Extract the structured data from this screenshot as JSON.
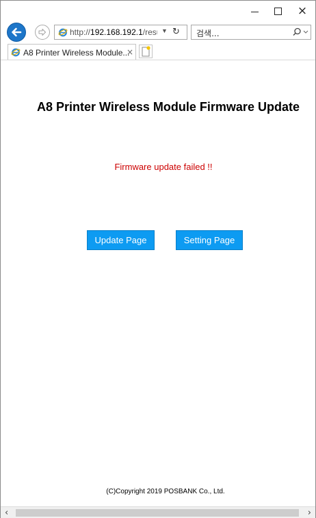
{
  "window": {
    "controls": {
      "minimize": "minimize",
      "maximize": "maximize",
      "close": "×"
    }
  },
  "address_bar": {
    "url_prefix": "http://",
    "url_host": "192.168.192.1",
    "url_rest": "/resu",
    "search_placeholder": "검색..."
  },
  "tab": {
    "title": "A8 Printer Wireless Module...",
    "close": "×"
  },
  "page": {
    "title": "A8 Printer Wireless Module Firmware Update",
    "status_message": "Firmware update failed !!",
    "status_color": "#cc0000",
    "buttons": {
      "update_page": "Update Page",
      "setting_page": "Setting Page"
    },
    "button_color": "#0d9bf2",
    "copyright": "(C)Copyright 2019 POSBANK Co., Ltd."
  },
  "scrollbar": {
    "left": "‹",
    "right": "›"
  }
}
